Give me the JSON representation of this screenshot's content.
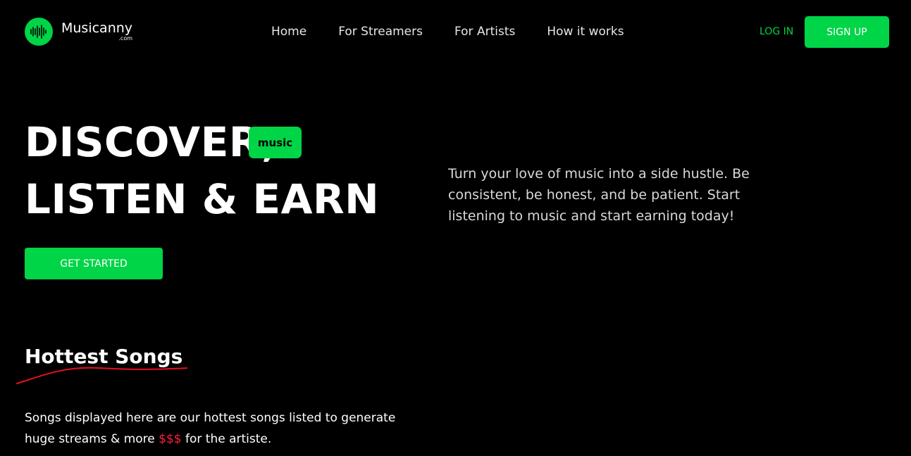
{
  "brand": {
    "name": "Musicanny",
    "tld": ".com",
    "icon": "soundwave-icon",
    "accent_color": "#00d447"
  },
  "nav": {
    "items": [
      {
        "label": "Home"
      },
      {
        "label": "For Streamers"
      },
      {
        "label": "For Artists"
      },
      {
        "label": "How it works"
      }
    ]
  },
  "auth": {
    "login_label": "LOG IN",
    "signup_label": "SIGN UP"
  },
  "hero": {
    "line1": "DISCOVER,",
    "badge": "music",
    "line2": "LISTEN & EARN",
    "cta_label": "GET STARTED",
    "description": "Turn your love of music into a side hustle. Be consistent, be honest, and be patient. Start listening to music and start earning today!"
  },
  "hottest": {
    "title": "Hottest Songs",
    "desc_before": "Songs displayed here are our hottest songs listed to generate huge streams & more ",
    "desc_money": "$$$",
    "desc_after": " for the artiste.",
    "underline_color": "#e8101e",
    "money_color": "#ff1f3d"
  }
}
